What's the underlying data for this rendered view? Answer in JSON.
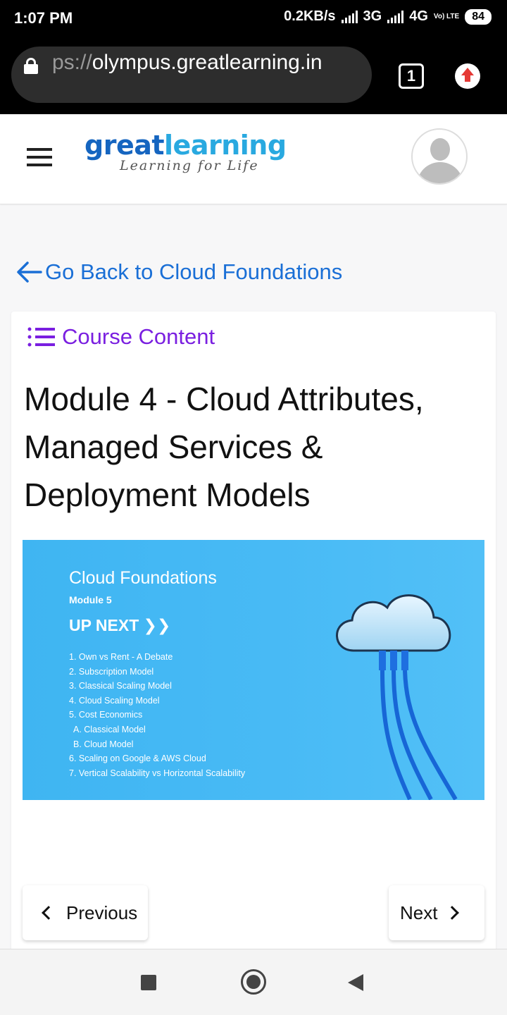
{
  "status_bar": {
    "time": "1:07 PM",
    "speed": "0.2KB/s",
    "network_3g": "3G",
    "network_4g": "4G",
    "volte": "Vo) LTE",
    "battery": "84"
  },
  "browser": {
    "url_dim": "ps://",
    "url_main": "olympus.greatlearning.in",
    "tab_count": "1",
    "icons": [
      "lock-icon",
      "tabs-icon",
      "update-icon"
    ]
  },
  "header": {
    "logo_great": "great",
    "logo_learning": "learning",
    "logo_tagline": "Learning for Life",
    "brand_colors": {
      "great": "#1565c0",
      "learning": "#29a9e0"
    }
  },
  "back_link": {
    "label": "Go Back to Cloud Foundations",
    "color": "#1a6fd6"
  },
  "card": {
    "course_content_label": "Course Content",
    "course_content_color": "#7a1fe0",
    "module_title": "Module 4 - Cloud Attributes, Managed Services & Deployment Models",
    "banner": {
      "title": "Cloud Foundations",
      "module": "Module 5",
      "up_next": "UP NEXT",
      "items": [
        "1. Own vs Rent - A Debate",
        "2. Subscription Model",
        "3. Classical Scaling Model",
        "4. Cloud Scaling Model",
        "5. Cost Economics",
        "A. Classical Model",
        "B. Cloud Model",
        "6. Scaling on Google & AWS Cloud",
        "7. Vertical Scalability vs Horizontal Scalability"
      ]
    }
  },
  "navigation": {
    "previous_label": "Previous",
    "next_label": "Next"
  }
}
